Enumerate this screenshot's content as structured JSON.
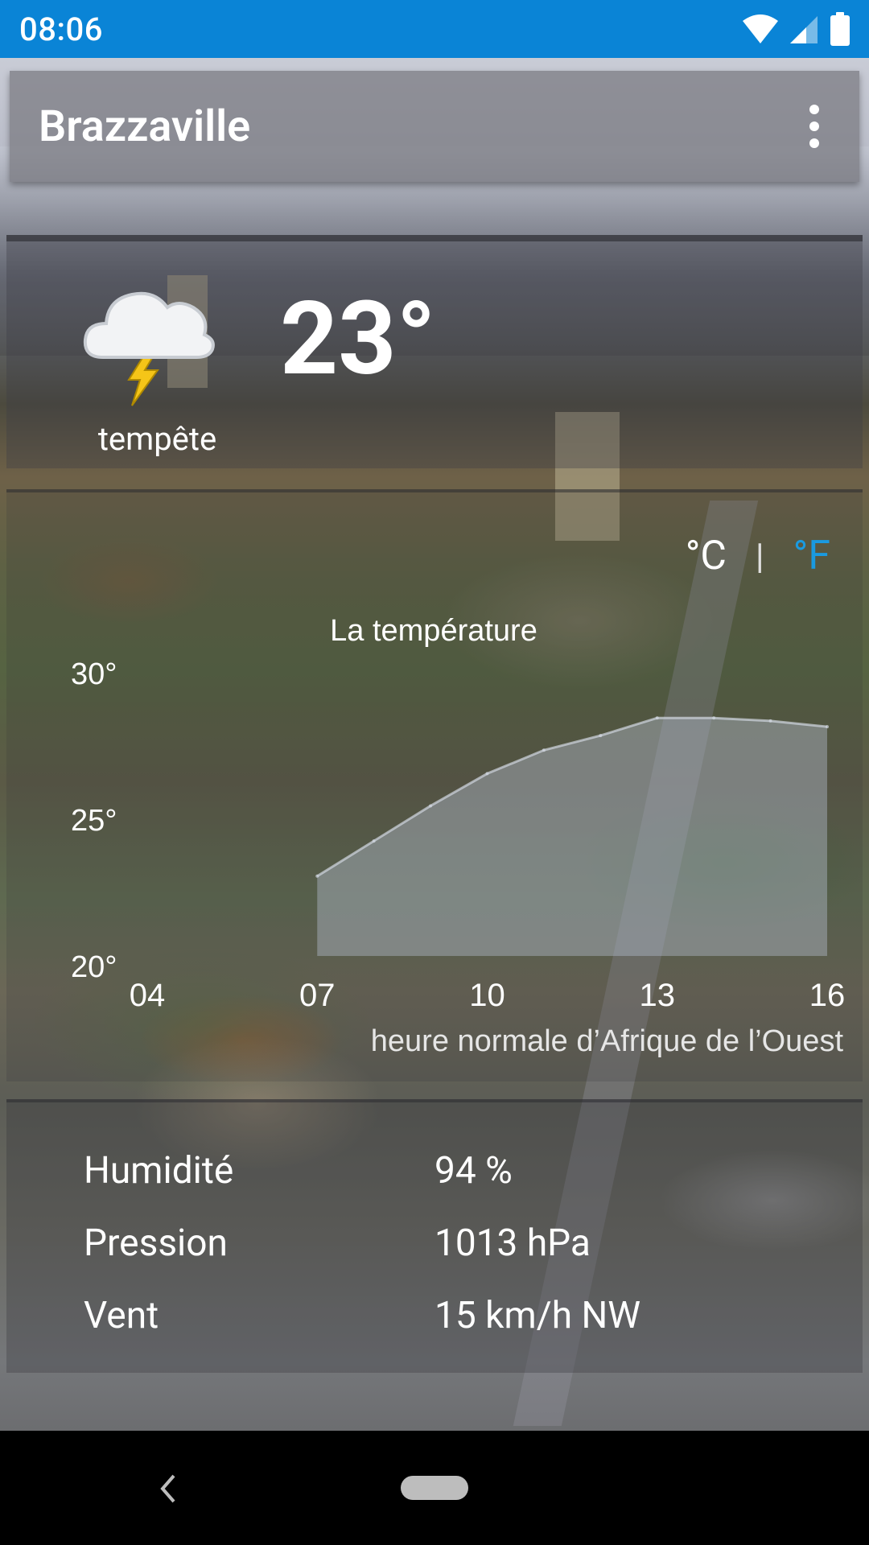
{
  "status_bar": {
    "time": "08:06",
    "icons": [
      "wifi-icon",
      "signal-icon",
      "battery-icon"
    ],
    "background": "#0a84d6"
  },
  "app_bar": {
    "title": "Brazzaville",
    "menu_icon": "more-vert-icon"
  },
  "current": {
    "icon": "cloud-lightning-icon",
    "condition": "tempête",
    "temperature": "23°"
  },
  "units": {
    "celsius": "°C",
    "separator": "|",
    "fahrenheit": "°F",
    "active_color": "#ffffff",
    "inactive_color": "#1a9ae0"
  },
  "chart_data": {
    "type": "area",
    "title": "La température",
    "xlabel": "heure normale d’Afrique de l’Ouest",
    "ylabel": "",
    "x_ticks": [
      "04",
      "07",
      "10",
      "13",
      "16"
    ],
    "y_ticks": [
      "20°",
      "25°",
      "30°"
    ],
    "ylim": [
      20,
      30
    ],
    "x": [
      7,
      8,
      9,
      10,
      11,
      12,
      13,
      14,
      15,
      16
    ],
    "values": [
      23,
      24.2,
      25.4,
      26.5,
      27.3,
      27.8,
      28.4,
      28.4,
      28.3,
      28.1
    ],
    "fill_color": "rgba(175,185,200,0.45)",
    "line_color": "rgba(210,215,225,0.7)"
  },
  "details": [
    {
      "label": "Humidité",
      "value": "94 %"
    },
    {
      "label": "Pression",
      "value": "1013 hPa"
    },
    {
      "label": "Vent",
      "value": "15 km/h NW"
    }
  ],
  "nav": {
    "back_icon": "back-icon",
    "home_icon": "home-pill-icon"
  }
}
